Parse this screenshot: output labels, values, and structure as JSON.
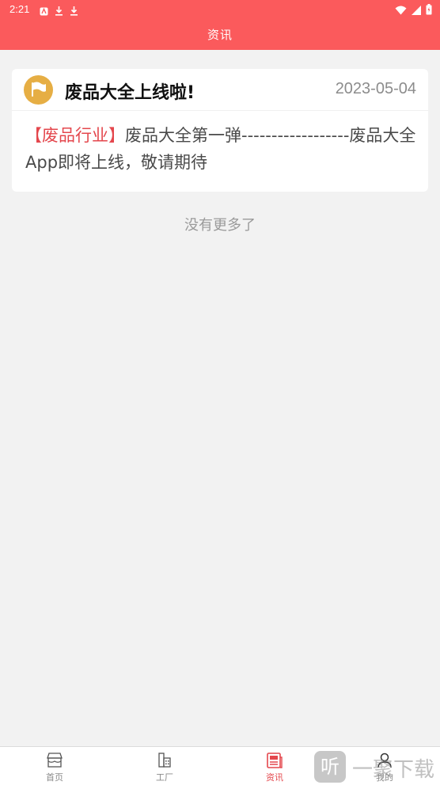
{
  "status_bar": {
    "time": "2:21"
  },
  "header": {
    "title": "资讯"
  },
  "news": [
    {
      "title": "废品大全上线啦!",
      "date": "2023-05-04",
      "tag": "【废品行业】",
      "content": "废品大全第一弹------------------废品大全App即将上线，敬请期待"
    }
  ],
  "list_footer": "没有更多了",
  "tabbar": {
    "tabs": [
      {
        "label": "首页",
        "icon": "shop-icon"
      },
      {
        "label": "工厂",
        "icon": "building-icon"
      },
      {
        "label": "资讯",
        "icon": "news-icon",
        "active": true
      },
      {
        "label": "我的",
        "icon": "person-icon"
      }
    ]
  },
  "watermark": {
    "text": "一聚下载",
    "logo_char": "听"
  },
  "colors": {
    "brand": "#fb5a5c",
    "tag": "#e4474d",
    "flag_badge": "#e6ae44",
    "background": "#f2f2f2"
  }
}
